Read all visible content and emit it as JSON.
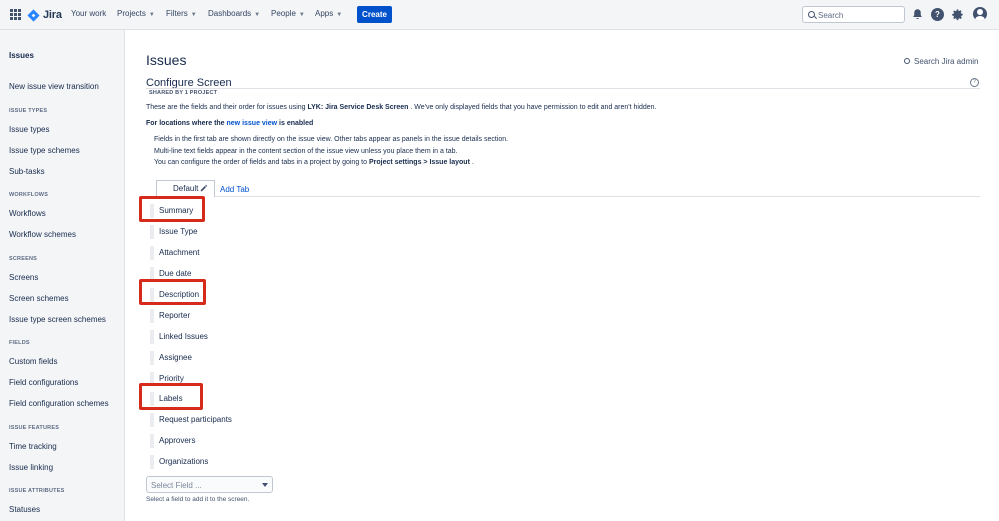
{
  "topnav": {
    "logo_text": "Jira",
    "items": [
      {
        "label": "Your work",
        "has_chevron": false
      },
      {
        "label": "Projects",
        "has_chevron": true
      },
      {
        "label": "Filters",
        "has_chevron": true
      },
      {
        "label": "Dashboards",
        "has_chevron": true
      },
      {
        "label": "People",
        "has_chevron": true
      },
      {
        "label": "Apps",
        "has_chevron": true
      }
    ],
    "create_label": "Create",
    "search_placeholder": "Search",
    "icons": [
      "app-switcher-icon",
      "jira-logo-icon",
      "notifications-bell-icon",
      "help-icon",
      "settings-gear-icon",
      "user-avatar-icon"
    ],
    "accent_color": "#0052cc"
  },
  "sidebar": {
    "title": "Issues",
    "top_link": "New issue view transition",
    "sections": [
      {
        "heading": "ISSUE TYPES",
        "items": [
          "Issue types",
          "Issue type schemes",
          "Sub-tasks"
        ]
      },
      {
        "heading": "WORKFLOWS",
        "items": [
          "Workflows",
          "Workflow schemes"
        ]
      },
      {
        "heading": "SCREENS",
        "items": [
          "Screens",
          "Screen schemes",
          "Issue type screen schemes"
        ]
      },
      {
        "heading": "FIELDS",
        "items": [
          "Custom fields",
          "Field configurations",
          "Field configuration schemes"
        ]
      },
      {
        "heading": "ISSUE FEATURES",
        "items": [
          "Time tracking",
          "Issue linking"
        ]
      },
      {
        "heading": "ISSUE ATTRIBUTES",
        "items": [
          "Statuses"
        ]
      }
    ]
  },
  "main": {
    "title": "Issues",
    "admin_search_label": "Search Jira admin",
    "screen_heading": "Configure Screen",
    "shared_by": "SHARED BY 1 PROJECT",
    "description_prefix": "These are the fields and their order for issues using ",
    "description_screen": "LYK: Jira Service Desk Screen",
    "description_suffix": " . We've only displayed fields that you have permission to edit and aren't hidden.",
    "locations_prefix": "For locations where the ",
    "locations_link": "new issue view",
    "locations_suffix": " is enabled",
    "info_line1": "Fields in the first tab are shown directly on the issue view. Other tabs appear as panels in the issue details section.",
    "info_line2": "Multi-line text fields appear in the content section of the issue view unless you place them in a tab.",
    "info_line3_prefix": "You can configure the order of fields and tabs in a project by going to ",
    "info_line3_bold": "Project settings > Issue layout",
    "info_line3_suffix": " .",
    "tab_default": "Default",
    "add_tab": "Add Tab",
    "fields": [
      "Summary",
      "Issue Type",
      "Attachment",
      "Due date",
      "Description",
      "Reporter",
      "Linked Issues",
      "Assignee",
      "Priority",
      "Labels",
      "Request participants",
      "Approvers",
      "Organizations"
    ],
    "highlighted_fields": [
      "Summary",
      "Description",
      "Labels"
    ],
    "highlight_color": "#d62a1a",
    "select_placeholder": "Select Field ...",
    "select_hint": "Select a field to add it to the screen."
  }
}
